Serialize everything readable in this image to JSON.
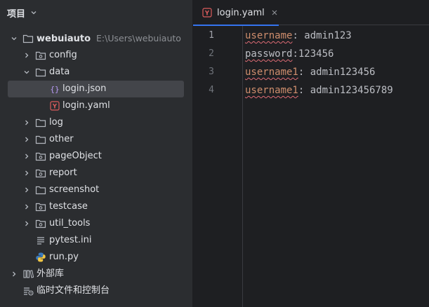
{
  "project_panel": {
    "title": "项目",
    "tree": [
      {
        "label": "webuiauto",
        "hint": "E:\\Users\\webuiauto"
      },
      {
        "label": "config"
      },
      {
        "label": "data"
      },
      {
        "label": "login.json"
      },
      {
        "label": "login.yaml"
      },
      {
        "label": "log"
      },
      {
        "label": "other"
      },
      {
        "label": "pageObject"
      },
      {
        "label": "report"
      },
      {
        "label": "screenshot"
      },
      {
        "label": "testcase"
      },
      {
        "label": "util_tools"
      },
      {
        "label": "pytest.ini"
      },
      {
        "label": "run.py"
      },
      {
        "label": "外部库"
      },
      {
        "label": "临时文件和控制台"
      }
    ]
  },
  "editor": {
    "tab": {
      "title": "login.yaml"
    },
    "line_numbers": [
      "1",
      "2",
      "3",
      "4"
    ],
    "lines": [
      {
        "key": "username",
        "sep": ": ",
        "value": "admin123"
      },
      {
        "key": "password",
        "sep": ":",
        "value": "123456"
      },
      {
        "key": "username1",
        "sep": ": ",
        "value": "admin123456"
      },
      {
        "key": "username1",
        "sep": ": ",
        "value": "admin123456789"
      }
    ]
  },
  "colors": {
    "panel_bg": "#2b2d30",
    "editor_bg": "#1e1f22",
    "selection": "#43454a",
    "yaml_key": "#cf8e6d",
    "typo_underline": "#e06c75",
    "accent": "#3574f0"
  }
}
